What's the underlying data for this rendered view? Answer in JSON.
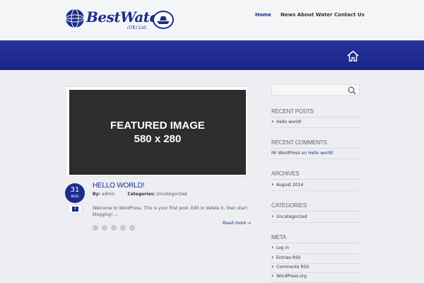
{
  "site": {
    "logo_text": "BestWater",
    "logo_sub": "(UK) Ltd."
  },
  "nav": {
    "items": [
      {
        "label": "Home",
        "active": true
      },
      {
        "label": "News About Water",
        "active": false
      },
      {
        "label": "Contact Us",
        "active": false
      }
    ]
  },
  "featured": {
    "line1": "FEATURED IMAGE",
    "line2": "580 x 280"
  },
  "post": {
    "day": "31",
    "month": "AUG",
    "comments": "1",
    "title": "Hello world!",
    "by_label": "By:",
    "author": "admin",
    "categories_label": "Categories:",
    "category": "Uncategorized",
    "excerpt": "Welcome to WordPress. This is your first post. Edit or delete it, then start blogging! ...",
    "read_more": "Read more →",
    "share_icons": [
      "facebook-icon",
      "twitter-icon",
      "digg-icon",
      "stumbleupon-icon",
      "delicious-icon"
    ]
  },
  "sidebar": {
    "search_placeholder": "",
    "recent_posts": {
      "title": "Recent Posts",
      "items": [
        "Hello world!"
      ]
    },
    "recent_comments": {
      "title": "Recent Comments",
      "author": "Mr WordPress",
      "on": "on",
      "post": "Hello world!"
    },
    "archives": {
      "title": "Archives",
      "items": [
        "August 2014"
      ]
    },
    "categories": {
      "title": "Categories",
      "items": [
        "Uncategorized"
      ]
    },
    "meta": {
      "title": "Meta",
      "items": [
        "Log in",
        "Entries RSS",
        "Comments RSS",
        "WordPress.org"
      ]
    }
  },
  "colors": {
    "brand": "#1c2c8a",
    "banner": "#1f2b8e",
    "background": "#edeef2"
  }
}
